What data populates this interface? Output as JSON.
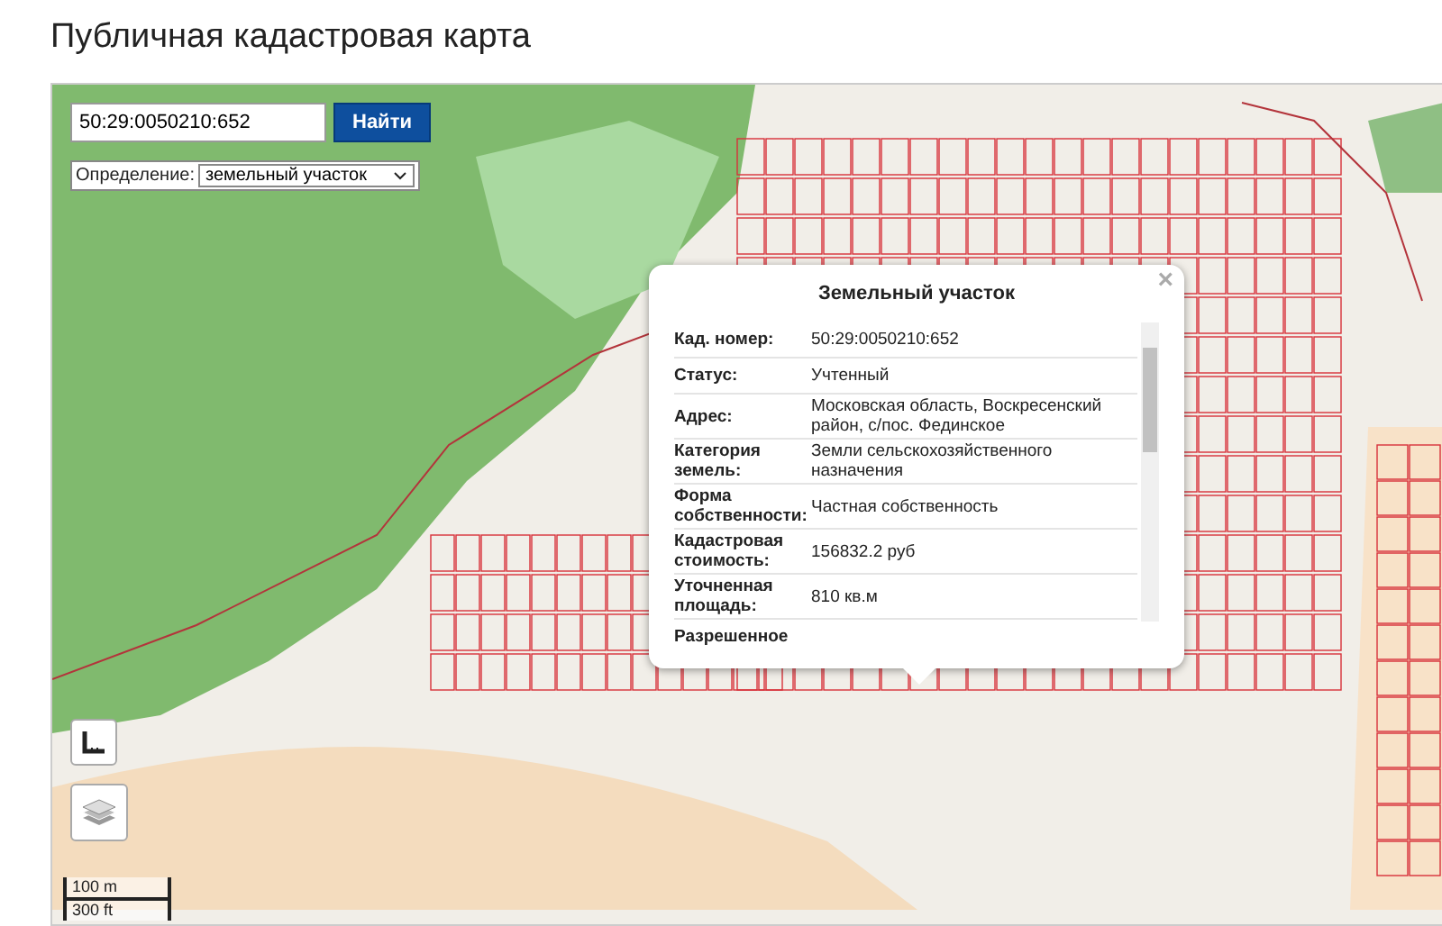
{
  "page_title": "Публичная кадастровая карта",
  "search": {
    "value": "50:29:0050210:652",
    "button": "Найти"
  },
  "definition": {
    "label": "Определение:",
    "value": "земельный участок"
  },
  "popup": {
    "title": "Земельный участок",
    "close": "×",
    "rows": [
      {
        "label": "Кад. номер:",
        "value": "50:29:0050210:652"
      },
      {
        "label": "Статус:",
        "value": "Учтенный"
      },
      {
        "label": "Адрес:",
        "value": "Московская область, Воскресенский район, с/пос. Фединское"
      },
      {
        "label": "Категория земель:",
        "value": "Земли сельскохозяйственного назначения"
      },
      {
        "label": "Форма собственности:",
        "value": "Частная собственность"
      },
      {
        "label": "Кадастровая стоимость:",
        "value": "156832.2 руб"
      },
      {
        "label": "Уточненная площадь:",
        "value": "810 кв.м"
      },
      {
        "label": "Разрешенное",
        "value": ""
      }
    ]
  },
  "scale": {
    "metric": "100 m",
    "imperial": "300 ft"
  }
}
